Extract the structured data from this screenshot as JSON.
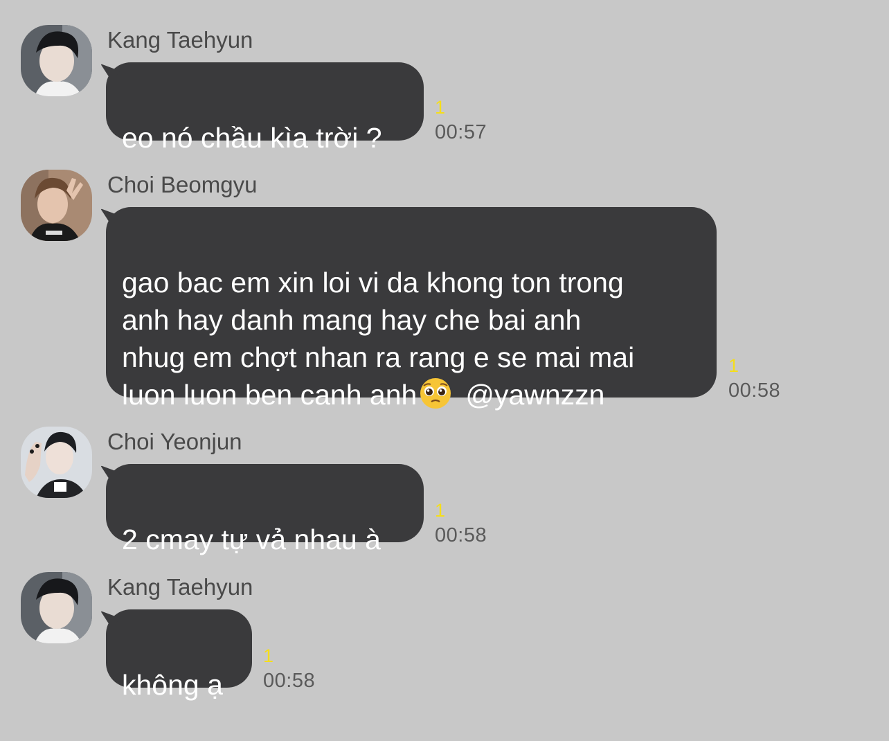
{
  "messages": [
    {
      "sender": "Kang Taehyun",
      "avatar_icon": "profile-photo-taehyun",
      "text_parts": [
        "eo nó chầu kìa trời ?"
      ],
      "unread": "1",
      "time": "00:57"
    },
    {
      "sender": "Choi Beomgyu",
      "avatar_icon": "profile-photo-beomgyu",
      "text_parts": [
        "gao bac em xin loi vi da khong ton trong\nanh hay danh mang hay che bai anh\nnhug em chợt nhan ra rang e se mai mai\nluon luon ben canh anh",
        "@yawnzzn"
      ],
      "emoji_icon": "pleading-face-emoji",
      "unread": "1",
      "time": "00:58"
    },
    {
      "sender": "Choi Yeonjun",
      "avatar_icon": "profile-photo-yeonjun",
      "text_parts": [
        "2 cmay tự vả nhau à"
      ],
      "unread": "1",
      "time": "00:58"
    },
    {
      "sender": "Kang Taehyun",
      "avatar_icon": "profile-photo-taehyun",
      "text_parts": [
        "không ạ"
      ],
      "unread": "1",
      "time": "00:58"
    }
  ],
  "colors": {
    "background": "#c8c8c8",
    "bubble": "#3a3a3c",
    "bubble_text": "#ffffff",
    "unread": "#f5de1a",
    "meta_text": "#5a5a5a"
  }
}
